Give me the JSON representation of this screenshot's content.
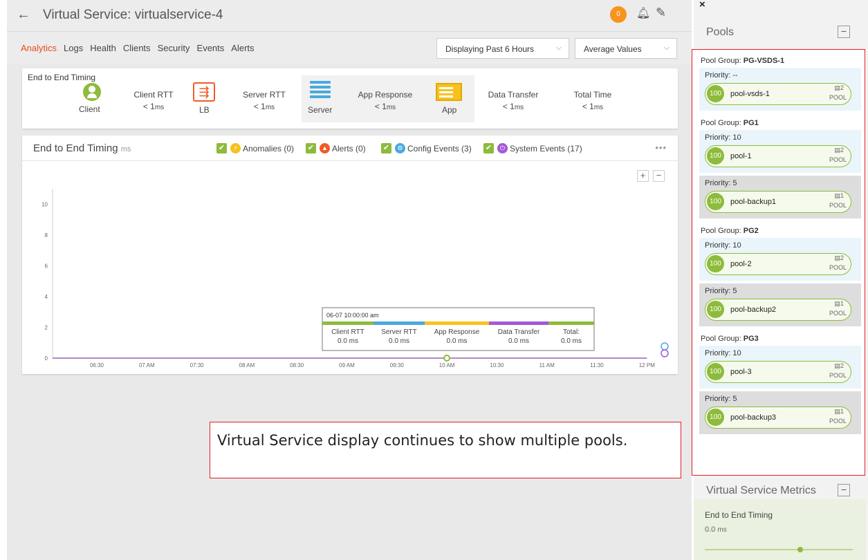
{
  "header": {
    "back_icon": "arrow-left-icon",
    "title": "Virtual Service: virtualservice-4",
    "badge_count": "0"
  },
  "nav": {
    "tabs": [
      "Analytics",
      "Logs",
      "Health",
      "Clients",
      "Security",
      "Events",
      "Alerts"
    ],
    "active_tab": "Analytics",
    "time_range": "Displaying Past 6 Hours",
    "value_type": "Average Values"
  },
  "timing_summary": {
    "label": "End to End Timing",
    "nodes": {
      "client": "Client",
      "lb": "LB",
      "server": "Server",
      "app": "App"
    },
    "metrics": [
      {
        "name": "Client RTT",
        "value": "< 1",
        "unit": "ms"
      },
      {
        "name": "Server RTT",
        "value": "< 1",
        "unit": "ms"
      },
      {
        "name": "App Response",
        "value": "< 1",
        "unit": "ms"
      },
      {
        "name": "Data Transfer",
        "value": "< 1",
        "unit": "ms"
      },
      {
        "name": "Total Time",
        "value": "< 1",
        "unit": "ms"
      }
    ]
  },
  "chart_panel": {
    "title": "End to End Timing",
    "unit": "ms",
    "legend": [
      {
        "label": "Anomalies (0)",
        "color": "#f7c21e",
        "icon": "bolt-icon"
      },
      {
        "label": "Alerts (0)",
        "color": "#f15a24",
        "icon": "bell-icon"
      },
      {
        "label": "Config Events (3)",
        "color": "#4aa9de",
        "icon": "gear-icon"
      },
      {
        "label": "System Events (17)",
        "color": "#a259d9",
        "icon": "power-icon"
      }
    ],
    "more": "•••",
    "zoom_in": "+",
    "zoom_out": "−"
  },
  "chart_data": {
    "type": "line",
    "x": [
      "06:30",
      "07 AM",
      "07:30",
      "08 AM",
      "08:30",
      "09 AM",
      "09:30",
      "10 AM",
      "10:30",
      "11 AM",
      "11:30",
      "12 PM"
    ],
    "series": [
      {
        "name": "Client RTT",
        "values": [
          0,
          0,
          0,
          0,
          0,
          0,
          0,
          0,
          0,
          0,
          0,
          0
        ],
        "color": "#8dbb3b"
      },
      {
        "name": "Server RTT",
        "values": [
          0,
          0,
          0,
          0,
          0,
          0,
          0,
          0,
          0,
          0,
          0,
          0
        ],
        "color": "#4aa9de"
      },
      {
        "name": "App Response",
        "values": [
          0,
          0,
          0,
          0,
          0,
          0,
          0,
          0,
          0,
          0,
          0,
          0
        ],
        "color": "#f7c21e"
      },
      {
        "name": "Data Transfer",
        "values": [
          0,
          0,
          0,
          0,
          0,
          0,
          0,
          0,
          0,
          0,
          0,
          0
        ],
        "color": "#a259d9"
      }
    ],
    "yticks": [
      "0",
      "2",
      "4",
      "6",
      "8",
      "10"
    ],
    "ylim": [
      0,
      11
    ],
    "tooltip": {
      "time": "06-07 10:00:00 am",
      "items": [
        {
          "label": "Client RTT",
          "value": "0.0",
          "unit": "ms",
          "color": "#8dbb3b"
        },
        {
          "label": "Server RTT",
          "value": "0.0",
          "unit": "ms",
          "color": "#4aa9de"
        },
        {
          "label": "App Response",
          "value": "0.0",
          "unit": "ms",
          "color": "#f7c21e"
        },
        {
          "label": "Data Transfer",
          "value": "0.0",
          "unit": "ms",
          "color": "#a259d9"
        },
        {
          "label": "Total:",
          "value": "0.0",
          "unit": "ms",
          "color": "#8dbb3b"
        }
      ]
    }
  },
  "pools_panel": {
    "close": "×",
    "title": "Pools",
    "minimize": "−",
    "groups": [
      {
        "label": "Pool Group:",
        "name": "PG-VSDS-1",
        "entries": [
          {
            "priority": "Priority: --",
            "score": "100",
            "pool": "pool-vsds-1",
            "count": "2",
            "tag": "POOL",
            "shade": "blue"
          }
        ]
      },
      {
        "label": "Pool Group:",
        "name": "PG1",
        "entries": [
          {
            "priority": "Priority: 10",
            "score": "100",
            "pool": "pool-1",
            "count": "2",
            "tag": "POOL",
            "shade": "blue"
          },
          {
            "priority": "Priority: 5",
            "score": "100",
            "pool": "pool-backup1",
            "count": "1",
            "tag": "POOL",
            "shade": "grey"
          }
        ]
      },
      {
        "label": "Pool Group:",
        "name": "PG2",
        "entries": [
          {
            "priority": "Priority: 10",
            "score": "100",
            "pool": "pool-2",
            "count": "2",
            "tag": "POOL",
            "shade": "blue"
          },
          {
            "priority": "Priority: 5",
            "score": "100",
            "pool": "pool-backup2",
            "count": "1",
            "tag": "POOL",
            "shade": "grey"
          }
        ]
      },
      {
        "label": "Pool Group:",
        "name": "PG3",
        "entries": [
          {
            "priority": "Priority: 10",
            "score": "100",
            "pool": "pool-3",
            "count": "2",
            "tag": "POOL",
            "shade": "blue"
          },
          {
            "priority": "Priority: 5",
            "score": "100",
            "pool": "pool-backup3",
            "count": "1",
            "tag": "POOL",
            "shade": "grey"
          }
        ]
      }
    ]
  },
  "metrics_panel": {
    "title": "Virtual Service Metrics",
    "minimize": "−",
    "label": "End to End Timing",
    "value": "0.0",
    "unit": "ms"
  },
  "callout": {
    "text": "Virtual Service display continues to show multiple pools."
  },
  "colors": {
    "accent": "#e74c1c",
    "ok_green": "#8dbb3b",
    "highlight_red": "#e31e24"
  }
}
